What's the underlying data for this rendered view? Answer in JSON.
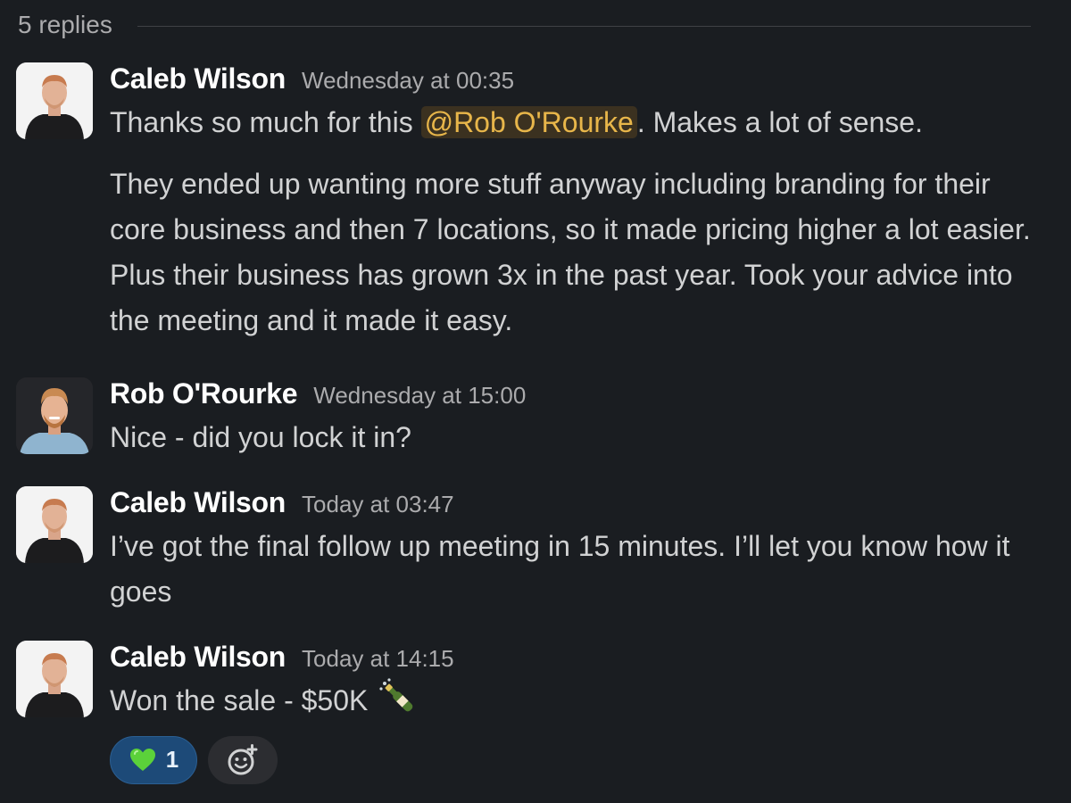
{
  "thread": {
    "replies_label": "5 replies"
  },
  "messages": [
    {
      "sender": "Caleb Wilson",
      "timestamp": "Wednesday at 00:35",
      "paragraph1_before": "Thanks so much for this ",
      "mention": "@Rob O'Rourke",
      "paragraph1_after": ". Makes a lot of sense.",
      "paragraph2": "They ended up wanting more stuff anyway including branding for their core business and then 7 locations, so it made pricing higher a lot easier. Plus their business has grown 3x in the past year. Took your advice into the meeting and it made it easy."
    },
    {
      "sender": "Rob O'Rourke",
      "timestamp": "Wednesday at 15:00",
      "text": "Nice - did you lock it in?"
    },
    {
      "sender": "Caleb Wilson",
      "timestamp": "Today at 03:47",
      "text": "I’ve got the final follow up meeting in 15 minutes. I’ll let you know how it goes"
    },
    {
      "sender": "Caleb Wilson",
      "timestamp": "Today at 14:15",
      "text": "Won the sale - $50K",
      "inline_emoji": "champagne-bottle",
      "reactions": [
        {
          "emoji": "green-heart",
          "count": "1"
        }
      ]
    }
  ],
  "colors": {
    "background": "#1a1d21",
    "mention_text": "#e8b64a",
    "mention_bg": "#3b3120",
    "reaction_bg": "#1d4a78"
  }
}
